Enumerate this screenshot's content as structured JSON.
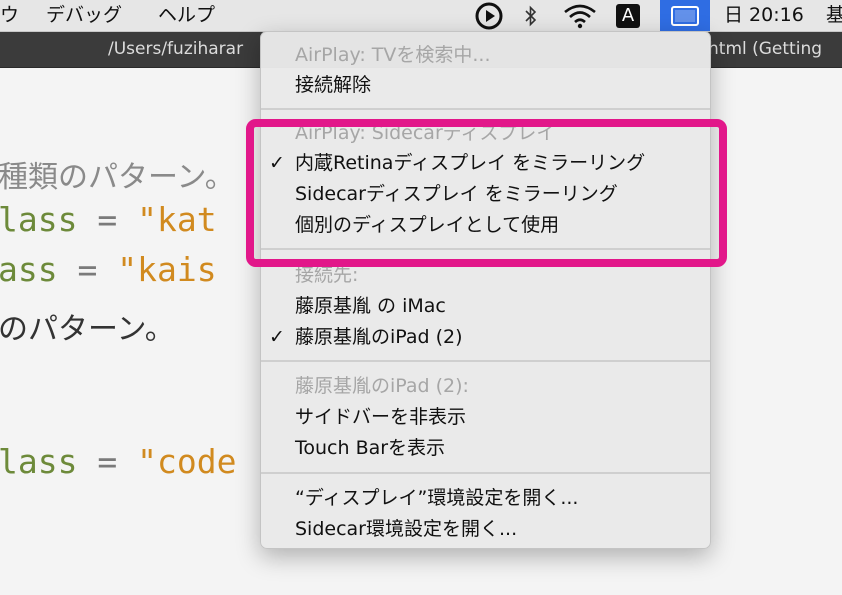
{
  "menubar": {
    "items": [
      {
        "label": "ウ"
      },
      {
        "label": "デバッグ"
      },
      {
        "label": "ヘルプ"
      }
    ],
    "status": {
      "input_mode_label": "A",
      "clock": "日 20:16",
      "trailing_label": "基"
    },
    "icons": {
      "play": "play-circle-icon",
      "bluetooth": "bluetooth-icon",
      "wifi": "wifi-icon",
      "input": "input-source-icon",
      "airplay": "airplay-display-icon"
    }
  },
  "window": {
    "title_left": "/Users/fuziharar",
    "title_right": "html (Getting"
  },
  "editor": {
    "lines": [
      {
        "text": "種類のパターン。"
      },
      {
        "part1": "lass",
        "part2": " = ",
        "part3": "\"kat"
      },
      {
        "part1": "ass",
        "part2": " = ",
        "part3": "\"kais"
      },
      {
        "text": "のパターン。"
      },
      {
        "part1": "lass",
        "part2": " = ",
        "part3": "\"code"
      }
    ]
  },
  "menu": {
    "sections": [
      {
        "header": "AirPlay: TVを検索中...",
        "items": [
          {
            "label": "接続解除",
            "checked": false
          }
        ]
      },
      {
        "header": "AirPlay: Sidecarディスプレイ",
        "items": [
          {
            "label": "内蔵Retinaディスプレイ をミラーリング",
            "checked": true
          },
          {
            "label": "Sidecarディスプレイ をミラーリング",
            "checked": false
          },
          {
            "label": "個別のディスプレイとして使用",
            "checked": false
          }
        ]
      },
      {
        "header": "接続先:",
        "items": [
          {
            "label": "藤原基胤 の iMac",
            "checked": false
          },
          {
            "label": "藤原基胤のiPad (2)",
            "checked": true
          }
        ]
      },
      {
        "header": "藤原基胤のiPad (2):",
        "items": [
          {
            "label": "サイドバーを非表示",
            "checked": false
          },
          {
            "label": "Touch Barを表示",
            "checked": false
          }
        ]
      },
      {
        "header": "",
        "items": [
          {
            "label": "“ディスプレイ”環境設定を開く...",
            "checked": false
          },
          {
            "label": "Sidecar環境設定を開く...",
            "checked": false
          }
        ]
      }
    ],
    "check_glyph": "✓"
  },
  "colors": {
    "highlight": "#e2178a",
    "menu_bg": "#e9e9e9",
    "header_text": "#a6a6a6",
    "airplay_selected": "#2f6de3",
    "code_keyword": "#6d8a3a",
    "code_string": "#d18a1f",
    "titlebar": "#3b3b3b"
  }
}
